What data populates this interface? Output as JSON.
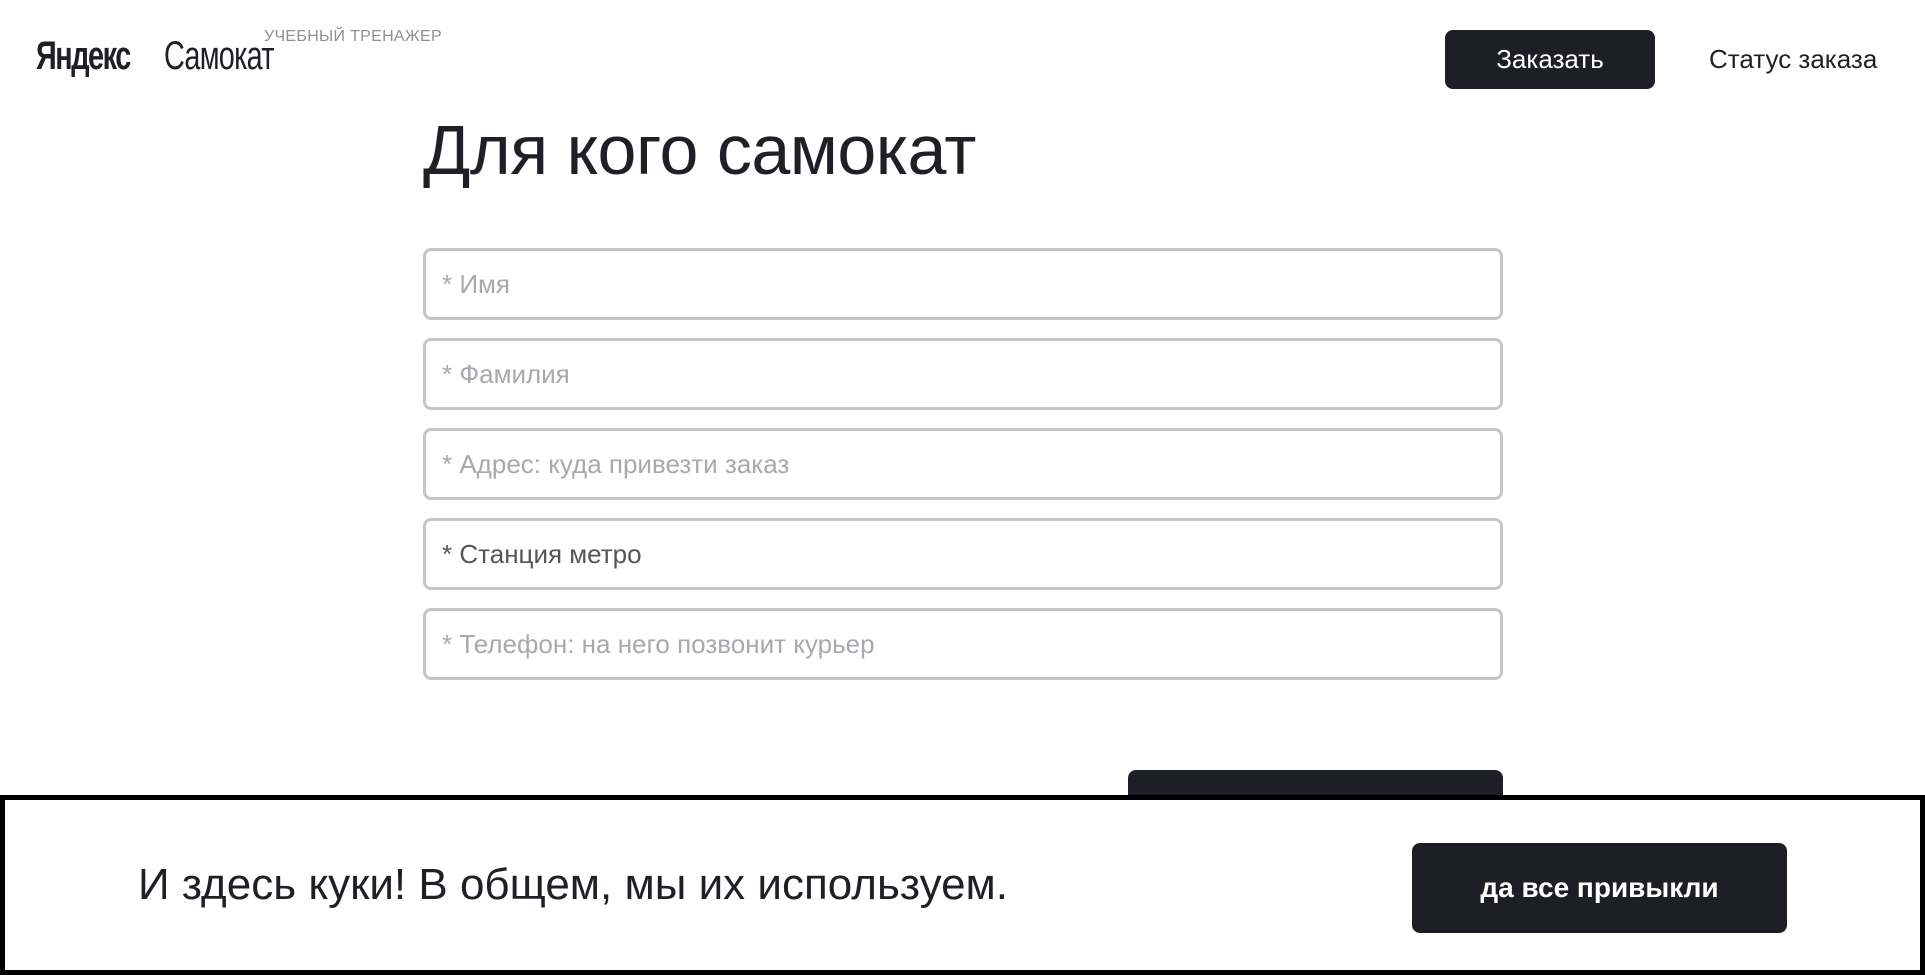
{
  "header": {
    "logo_yandex": "Яндекс",
    "logo_samokat": "Самокат",
    "logo_subtitle": "УЧЕБНЫЙ ТРЕНАЖЕР",
    "order_button": "Заказать",
    "status_link": "Статус заказа"
  },
  "main": {
    "title": "Для кого самокат",
    "fields": {
      "name_placeholder": "* Имя",
      "surname_placeholder": "* Фамилия",
      "address_placeholder": "* Адрес: куда привезти заказ",
      "metro_placeholder": "* Станция метро",
      "phone_placeholder": "* Телефон: на него позвонит курьер"
    }
  },
  "cookie_banner": {
    "text": "И здесь куки! В общем, мы их используем.",
    "button": "да все привыкли"
  },
  "colors": {
    "primary_dark": "#1e1e26",
    "field_border": "#c6c6c6",
    "placeholder": "#a9a9ad"
  }
}
